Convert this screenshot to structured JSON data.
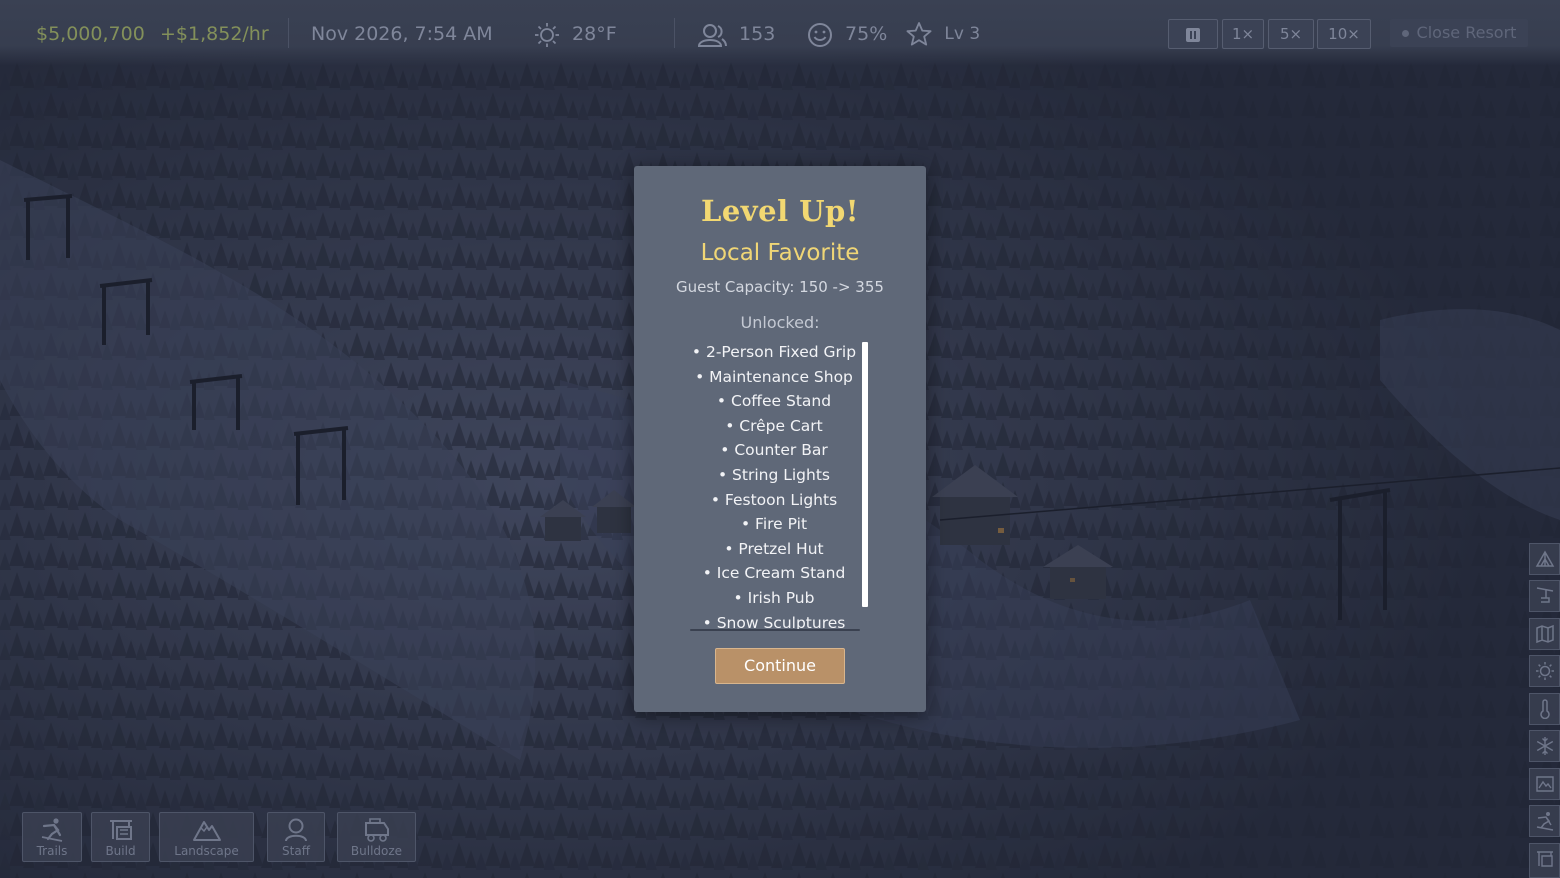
{
  "hud": {
    "money": "5,000,700",
    "currency_symbol": "$",
    "income": "+$1,852/hr",
    "datetime": "Nov 2026, 7:54 AM",
    "temperature": "28°F",
    "guests": "153",
    "happiness": "75%",
    "level": "Lv 3",
    "speed_1": "1×",
    "speed_5": "5×",
    "speed_10": "10×",
    "close_resort": "Close Resort"
  },
  "toolbar": {
    "trails": "Trails",
    "build": "Build",
    "landscape": "Landscape",
    "staff": "Staff",
    "bulldoze": "Bulldoze"
  },
  "side_toolbar": [
    "tent-icon",
    "chairlift-icon",
    "map-icon",
    "sun-icon",
    "thermometer-icon",
    "snowflake-icon",
    "mountain-map-icon",
    "trails-icon",
    "build-icon"
  ],
  "modal": {
    "title": "Level Up!",
    "subtitle": "Local Favorite",
    "capacity": "Guest Capacity: 150 -> 355",
    "unlocked_label": "Unlocked:",
    "items": [
      "• 2-Person Fixed Grip",
      "• Maintenance Shop",
      "• Coffee Stand",
      "• Crêpe Cart",
      "• Counter Bar",
      "• String Lights",
      "• Festoon Lights",
      "• Fire Pit",
      "• Pretzel Hut",
      "• Ice Cream Stand",
      "• Irish Pub",
      "• Snow Sculptures"
    ],
    "continue": "Continue"
  },
  "colors": {
    "title": "#f2d872",
    "modal_bg": "#5f6878",
    "button": "#b99168",
    "hud_green": "#83905a"
  }
}
